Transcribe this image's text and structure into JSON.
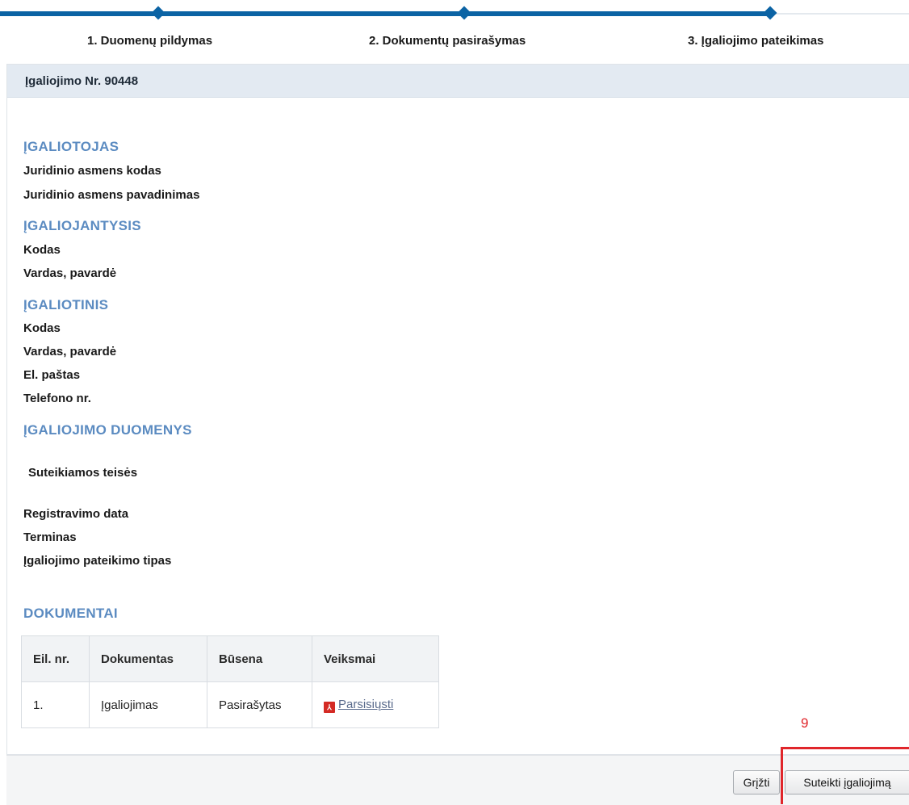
{
  "steps": [
    {
      "label": "1. Duomenų pildymas"
    },
    {
      "label": "2. Dokumentų pasirašymas"
    },
    {
      "label": "3. Įgaliojimo pateikimas"
    }
  ],
  "panel": {
    "title": "Įgaliojimo Nr. 90448"
  },
  "sections": {
    "igaliotojas": {
      "heading": "ĮGALIOTOJAS",
      "fields": [
        "Juridinio asmens kodas",
        "Juridinio asmens pavadinimas"
      ]
    },
    "igaliojantysis": {
      "heading": "ĮGALIOJANTYSIS",
      "fields": [
        "Kodas",
        "Vardas, pavardė"
      ]
    },
    "igaliotinis": {
      "heading": "ĮGALIOTINIS",
      "fields": [
        "Kodas",
        "Vardas, pavardė",
        "El. paštas",
        "Telefono nr."
      ]
    },
    "duomenys": {
      "heading": "ĮGALIOJIMO DUOMENYS",
      "rights_label": "Suteikiamos teisės",
      "fields": [
        "Registravimo data",
        "Terminas",
        "Įgaliojimo pateikimo tipas"
      ]
    },
    "dokumentai": {
      "heading": "DOKUMENTAI"
    }
  },
  "documents_table": {
    "headers": [
      "Eil. nr.",
      "Dokumentas",
      "Būsena",
      "Veiksmai"
    ],
    "rows": [
      {
        "nr": "1.",
        "document": "Įgaliojimas",
        "status": "Pasirašytas",
        "action": "Parsisiųsti",
        "action_icon": "pdf-icon"
      }
    ]
  },
  "footer": {
    "back_label": "Grįžti",
    "grant_label": "Suteikti įgaliojimą"
  },
  "annotation": {
    "number": "9",
    "color": "#e0262b"
  },
  "colors": {
    "progress": "#0b63a4",
    "section_heading": "#5b8bc1",
    "panel_header": "#e3eaf2"
  }
}
